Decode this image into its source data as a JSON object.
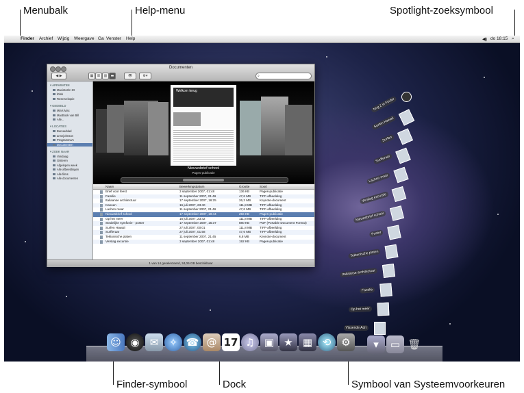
{
  "callouts": {
    "menubar": "Menubalk",
    "help_menu": "Help-menu",
    "spotlight": "Spotlight-zoeksymbool",
    "finder": "Finder-symbool",
    "dock": "Dock",
    "system_prefs": "Symbool van Systeemvoorkeuren"
  },
  "menubar": {
    "apple": "",
    "items": [
      "Finder",
      "Archief",
      "Wijzig",
      "Weergave",
      "Ga",
      "Venster",
      "Help"
    ],
    "volume": "◀)",
    "clock": "do 18:15",
    "search": "⌕"
  },
  "window": {
    "title": "Documenten",
    "sidebar": {
      "sections": [
        {
          "header": "▼APPARATEN",
          "items": [
            "Macintosh HD",
            "iDisk",
            "Reservekopie"
          ]
        },
        {
          "header": "▼GEDEELD",
          "items": [
            "Mia's Mac",
            "MacBook van Bill",
            "Alle..."
          ]
        },
        {
          "header": "▼LOCATIES",
          "items": [
            "Bureaublad",
            "annejohnson",
            "Programma's",
            "Documenten"
          ]
        },
        {
          "header": "▼ZOEK NAAR",
          "items": [
            "Vandaag",
            "Gisteren",
            "Afgelopen week",
            "Alle afbeeldingen",
            "Alle films",
            "Alle documenten"
          ]
        }
      ]
    },
    "coverflow": {
      "caption": "Nieuwsbrief school",
      "subcaption": "Pages-publicatie",
      "page_title": "Welkom terug"
    },
    "columns": [
      "Naam",
      "Bewerkingsdatum",
      "Grootte",
      "Soort"
    ],
    "rows": [
      [
        "Brief voor feest",
        "3 september 2007, 01:48",
        "136 KB",
        "Pages-publicatie"
      ],
      [
        "Familie",
        "11 september 2007, 21:46",
        "47,6 MB",
        "TIFF-afbeelding"
      ],
      [
        "Italiaanse architectuur",
        "17 september 2007, 16:25",
        "26,3 MB",
        "Keynote-document"
      ],
      [
        "Kanoen",
        "16 juli 2007, 23:40",
        "111,8 MB",
        "TIFF-afbeelding"
      ],
      [
        "Lachen maar",
        "11 september 2007, 21:46",
        "47,6 MB",
        "TIFF-afbeelding"
      ],
      [
        "Nieuwsbrief school",
        "17 september 2007, 19:44",
        "256 KB",
        "Pages-publicatie"
      ],
      [
        "Op het meer",
        "16 juli 2007, 23:42",
        "111,8 MB",
        "TIFF-afbeelding"
      ],
      [
        "Stedelijke symfonie - poster",
        "17 september 2007, 15:37",
        "880 KB",
        "PDF (Portable Document Format)"
      ],
      [
        "Surfen Hawaii",
        "27 juli 2007, 00:01",
        "111,8 MB",
        "TIFF-afbeelding"
      ],
      [
        "Surfferaar",
        "27 juli 2007, 01:58",
        "47,6 MB",
        "TIFF-afbeelding"
      ],
      [
        "Tektonische platen",
        "11 september 2007, 21:45",
        "6,8 MB",
        "Keynote-document"
      ],
      [
        "Verslag excursie",
        "3 september 2007, 01:48",
        "192 KB",
        "Pages-publicatie"
      ]
    ],
    "selected_row": 5,
    "status": "1 van 14 geselecteerd, 34,06 GB beschikbaar"
  },
  "stack": {
    "items": [
      "Nog 2 in Finder",
      "Surfen Hawaii",
      "Surfen",
      "Surfferaar",
      "Lachen maar",
      "Verslag excursie",
      "Nieuwsbrief school",
      "Poster",
      "Tektonische platen",
      "Italiaanse architectuur",
      "Familie",
      "Op het meer",
      "Vissende Adri"
    ]
  }
}
